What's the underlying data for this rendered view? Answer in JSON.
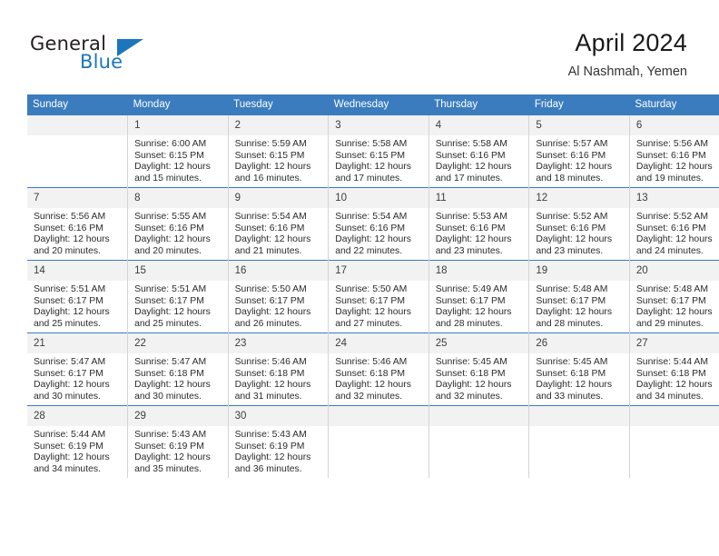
{
  "brand": {
    "name_top": "General",
    "name_bottom": "Blue",
    "accent_color": "#1b76bc"
  },
  "header": {
    "title": "April 2024",
    "subtitle": "Al Nashmah, Yemen"
  },
  "calendar": {
    "header_bg": "#3a7cbe",
    "daynum_bg": "#f2f2f2",
    "weekdays": [
      "Sunday",
      "Monday",
      "Tuesday",
      "Wednesday",
      "Thursday",
      "Friday",
      "Saturday"
    ],
    "weeks": [
      [
        {
          "day": "",
          "lines": []
        },
        {
          "day": "1",
          "lines": [
            "Sunrise: 6:00 AM",
            "Sunset: 6:15 PM",
            "Daylight: 12 hours",
            "and 15 minutes."
          ]
        },
        {
          "day": "2",
          "lines": [
            "Sunrise: 5:59 AM",
            "Sunset: 6:15 PM",
            "Daylight: 12 hours",
            "and 16 minutes."
          ]
        },
        {
          "day": "3",
          "lines": [
            "Sunrise: 5:58 AM",
            "Sunset: 6:15 PM",
            "Daylight: 12 hours",
            "and 17 minutes."
          ]
        },
        {
          "day": "4",
          "lines": [
            "Sunrise: 5:58 AM",
            "Sunset: 6:16 PM",
            "Daylight: 12 hours",
            "and 17 minutes."
          ]
        },
        {
          "day": "5",
          "lines": [
            "Sunrise: 5:57 AM",
            "Sunset: 6:16 PM",
            "Daylight: 12 hours",
            "and 18 minutes."
          ]
        },
        {
          "day": "6",
          "lines": [
            "Sunrise: 5:56 AM",
            "Sunset: 6:16 PM",
            "Daylight: 12 hours",
            "and 19 minutes."
          ]
        }
      ],
      [
        {
          "day": "7",
          "lines": [
            "Sunrise: 5:56 AM",
            "Sunset: 6:16 PM",
            "Daylight: 12 hours",
            "and 20 minutes."
          ]
        },
        {
          "day": "8",
          "lines": [
            "Sunrise: 5:55 AM",
            "Sunset: 6:16 PM",
            "Daylight: 12 hours",
            "and 20 minutes."
          ]
        },
        {
          "day": "9",
          "lines": [
            "Sunrise: 5:54 AM",
            "Sunset: 6:16 PM",
            "Daylight: 12 hours",
            "and 21 minutes."
          ]
        },
        {
          "day": "10",
          "lines": [
            "Sunrise: 5:54 AM",
            "Sunset: 6:16 PM",
            "Daylight: 12 hours",
            "and 22 minutes."
          ]
        },
        {
          "day": "11",
          "lines": [
            "Sunrise: 5:53 AM",
            "Sunset: 6:16 PM",
            "Daylight: 12 hours",
            "and 23 minutes."
          ]
        },
        {
          "day": "12",
          "lines": [
            "Sunrise: 5:52 AM",
            "Sunset: 6:16 PM",
            "Daylight: 12 hours",
            "and 23 minutes."
          ]
        },
        {
          "day": "13",
          "lines": [
            "Sunrise: 5:52 AM",
            "Sunset: 6:16 PM",
            "Daylight: 12 hours",
            "and 24 minutes."
          ]
        }
      ],
      [
        {
          "day": "14",
          "lines": [
            "Sunrise: 5:51 AM",
            "Sunset: 6:17 PM",
            "Daylight: 12 hours",
            "and 25 minutes."
          ]
        },
        {
          "day": "15",
          "lines": [
            "Sunrise: 5:51 AM",
            "Sunset: 6:17 PM",
            "Daylight: 12 hours",
            "and 25 minutes."
          ]
        },
        {
          "day": "16",
          "lines": [
            "Sunrise: 5:50 AM",
            "Sunset: 6:17 PM",
            "Daylight: 12 hours",
            "and 26 minutes."
          ]
        },
        {
          "day": "17",
          "lines": [
            "Sunrise: 5:50 AM",
            "Sunset: 6:17 PM",
            "Daylight: 12 hours",
            "and 27 minutes."
          ]
        },
        {
          "day": "18",
          "lines": [
            "Sunrise: 5:49 AM",
            "Sunset: 6:17 PM",
            "Daylight: 12 hours",
            "and 28 minutes."
          ]
        },
        {
          "day": "19",
          "lines": [
            "Sunrise: 5:48 AM",
            "Sunset: 6:17 PM",
            "Daylight: 12 hours",
            "and 28 minutes."
          ]
        },
        {
          "day": "20",
          "lines": [
            "Sunrise: 5:48 AM",
            "Sunset: 6:17 PM",
            "Daylight: 12 hours",
            "and 29 minutes."
          ]
        }
      ],
      [
        {
          "day": "21",
          "lines": [
            "Sunrise: 5:47 AM",
            "Sunset: 6:17 PM",
            "Daylight: 12 hours",
            "and 30 minutes."
          ]
        },
        {
          "day": "22",
          "lines": [
            "Sunrise: 5:47 AM",
            "Sunset: 6:18 PM",
            "Daylight: 12 hours",
            "and 30 minutes."
          ]
        },
        {
          "day": "23",
          "lines": [
            "Sunrise: 5:46 AM",
            "Sunset: 6:18 PM",
            "Daylight: 12 hours",
            "and 31 minutes."
          ]
        },
        {
          "day": "24",
          "lines": [
            "Sunrise: 5:46 AM",
            "Sunset: 6:18 PM",
            "Daylight: 12 hours",
            "and 32 minutes."
          ]
        },
        {
          "day": "25",
          "lines": [
            "Sunrise: 5:45 AM",
            "Sunset: 6:18 PM",
            "Daylight: 12 hours",
            "and 32 minutes."
          ]
        },
        {
          "day": "26",
          "lines": [
            "Sunrise: 5:45 AM",
            "Sunset: 6:18 PM",
            "Daylight: 12 hours",
            "and 33 minutes."
          ]
        },
        {
          "day": "27",
          "lines": [
            "Sunrise: 5:44 AM",
            "Sunset: 6:18 PM",
            "Daylight: 12 hours",
            "and 34 minutes."
          ]
        }
      ],
      [
        {
          "day": "28",
          "lines": [
            "Sunrise: 5:44 AM",
            "Sunset: 6:19 PM",
            "Daylight: 12 hours",
            "and 34 minutes."
          ]
        },
        {
          "day": "29",
          "lines": [
            "Sunrise: 5:43 AM",
            "Sunset: 6:19 PM",
            "Daylight: 12 hours",
            "and 35 minutes."
          ]
        },
        {
          "day": "30",
          "lines": [
            "Sunrise: 5:43 AM",
            "Sunset: 6:19 PM",
            "Daylight: 12 hours",
            "and 36 minutes."
          ]
        },
        {
          "day": "",
          "lines": []
        },
        {
          "day": "",
          "lines": []
        },
        {
          "day": "",
          "lines": []
        },
        {
          "day": "",
          "lines": []
        }
      ]
    ]
  }
}
